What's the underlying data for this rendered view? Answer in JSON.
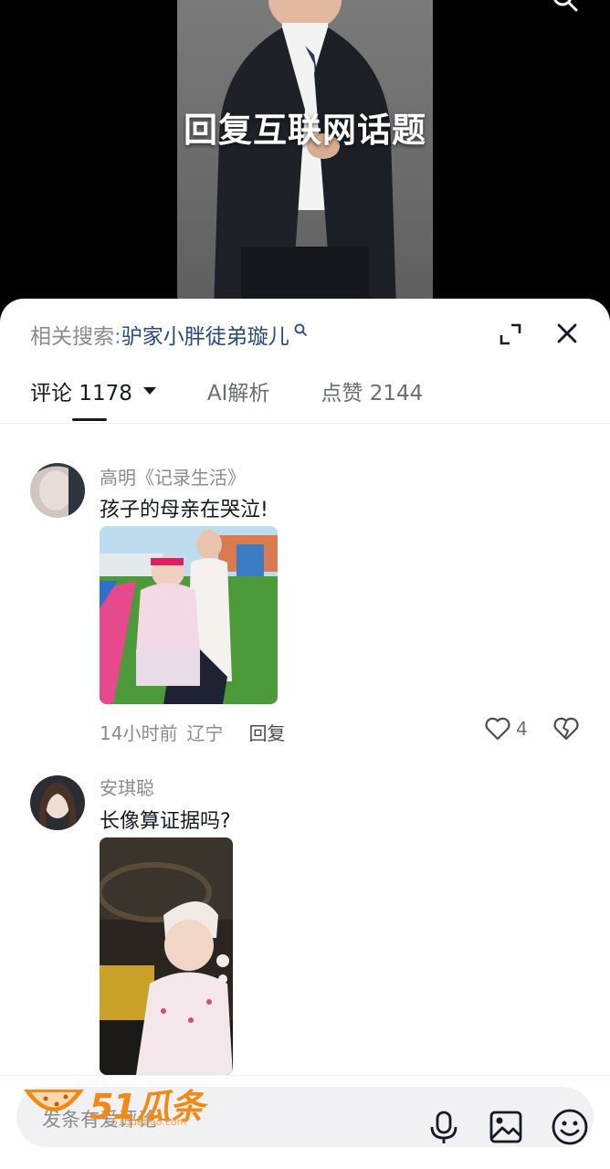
{
  "video": {
    "caption": "回复互联网话题"
  },
  "sheet": {
    "related_label": "相关搜索:",
    "related_keyword": "驴家小胖徒弟璇儿",
    "tabs": [
      {
        "label": "评论 1178",
        "active": true
      },
      {
        "label": "AI解析",
        "active": false
      },
      {
        "label": "点赞 2144",
        "active": false
      }
    ]
  },
  "comments": [
    {
      "user": "高明《记录生活》",
      "text": "孩子的母亲在哭泣!",
      "time": "14小时前",
      "location": "辽宁",
      "reply_label": "回复",
      "likes": "4"
    },
    {
      "user": "安琪聪",
      "text": "长像算证据吗?"
    }
  ],
  "input": {
    "placeholder": "发条有爱评论~"
  },
  "watermark": {
    "brand": "51瓜条",
    "url": "51guatiao.com"
  },
  "icons": {
    "search": "search-icon",
    "expand": "expand-icon",
    "close": "close-icon",
    "heart": "heart-icon",
    "dislike": "broken-heart-icon",
    "mic": "microphone-icon",
    "image": "image-icon",
    "emoji": "emoji-icon"
  },
  "colors": {
    "accent_link": "#2a4a7a",
    "watermark": "#f08a14"
  }
}
